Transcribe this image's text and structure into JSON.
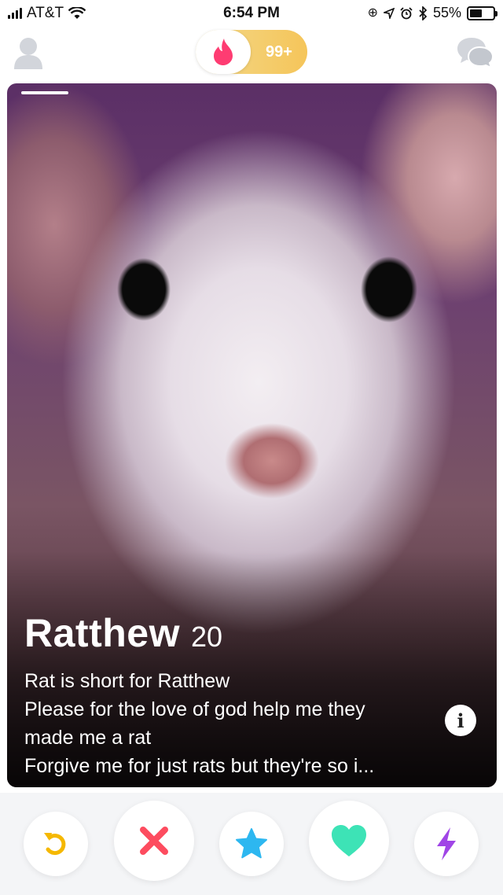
{
  "status_bar": {
    "carrier": "AT&T",
    "time": "6:54 PM",
    "battery_percent": "55%",
    "battery_level": 0.55,
    "icons": [
      "signal-icon",
      "wifi-icon",
      "orientation-lock-icon",
      "location-icon",
      "alarm-icon",
      "bluetooth-icon",
      "battery-icon"
    ]
  },
  "top_nav": {
    "icons": [
      "profile-icon",
      "flame-icon",
      "chat-icon"
    ],
    "count_badge": "99+",
    "accent_color": "#fe3c72",
    "toggle_color": "#f5c55a"
  },
  "profile": {
    "name": "Ratthew",
    "age": "20",
    "bio": [
      "Rat is short for Ratthew",
      "Please for the love of god help me they",
      "made me a rat",
      "Forgive me for just rats but they're so i..."
    ],
    "info_label": "i"
  },
  "actions": {
    "buttons": [
      {
        "name": "rewind",
        "icon": "undo-icon",
        "color": "#f5b800"
      },
      {
        "name": "nope",
        "icon": "x-icon",
        "color": "#fd4c5f"
      },
      {
        "name": "super-like",
        "icon": "star-icon",
        "color": "#2db7f0"
      },
      {
        "name": "like",
        "icon": "heart-icon",
        "color": "#3de3b6"
      },
      {
        "name": "boost",
        "icon": "lightning-icon",
        "color": "#a045e6"
      }
    ]
  }
}
